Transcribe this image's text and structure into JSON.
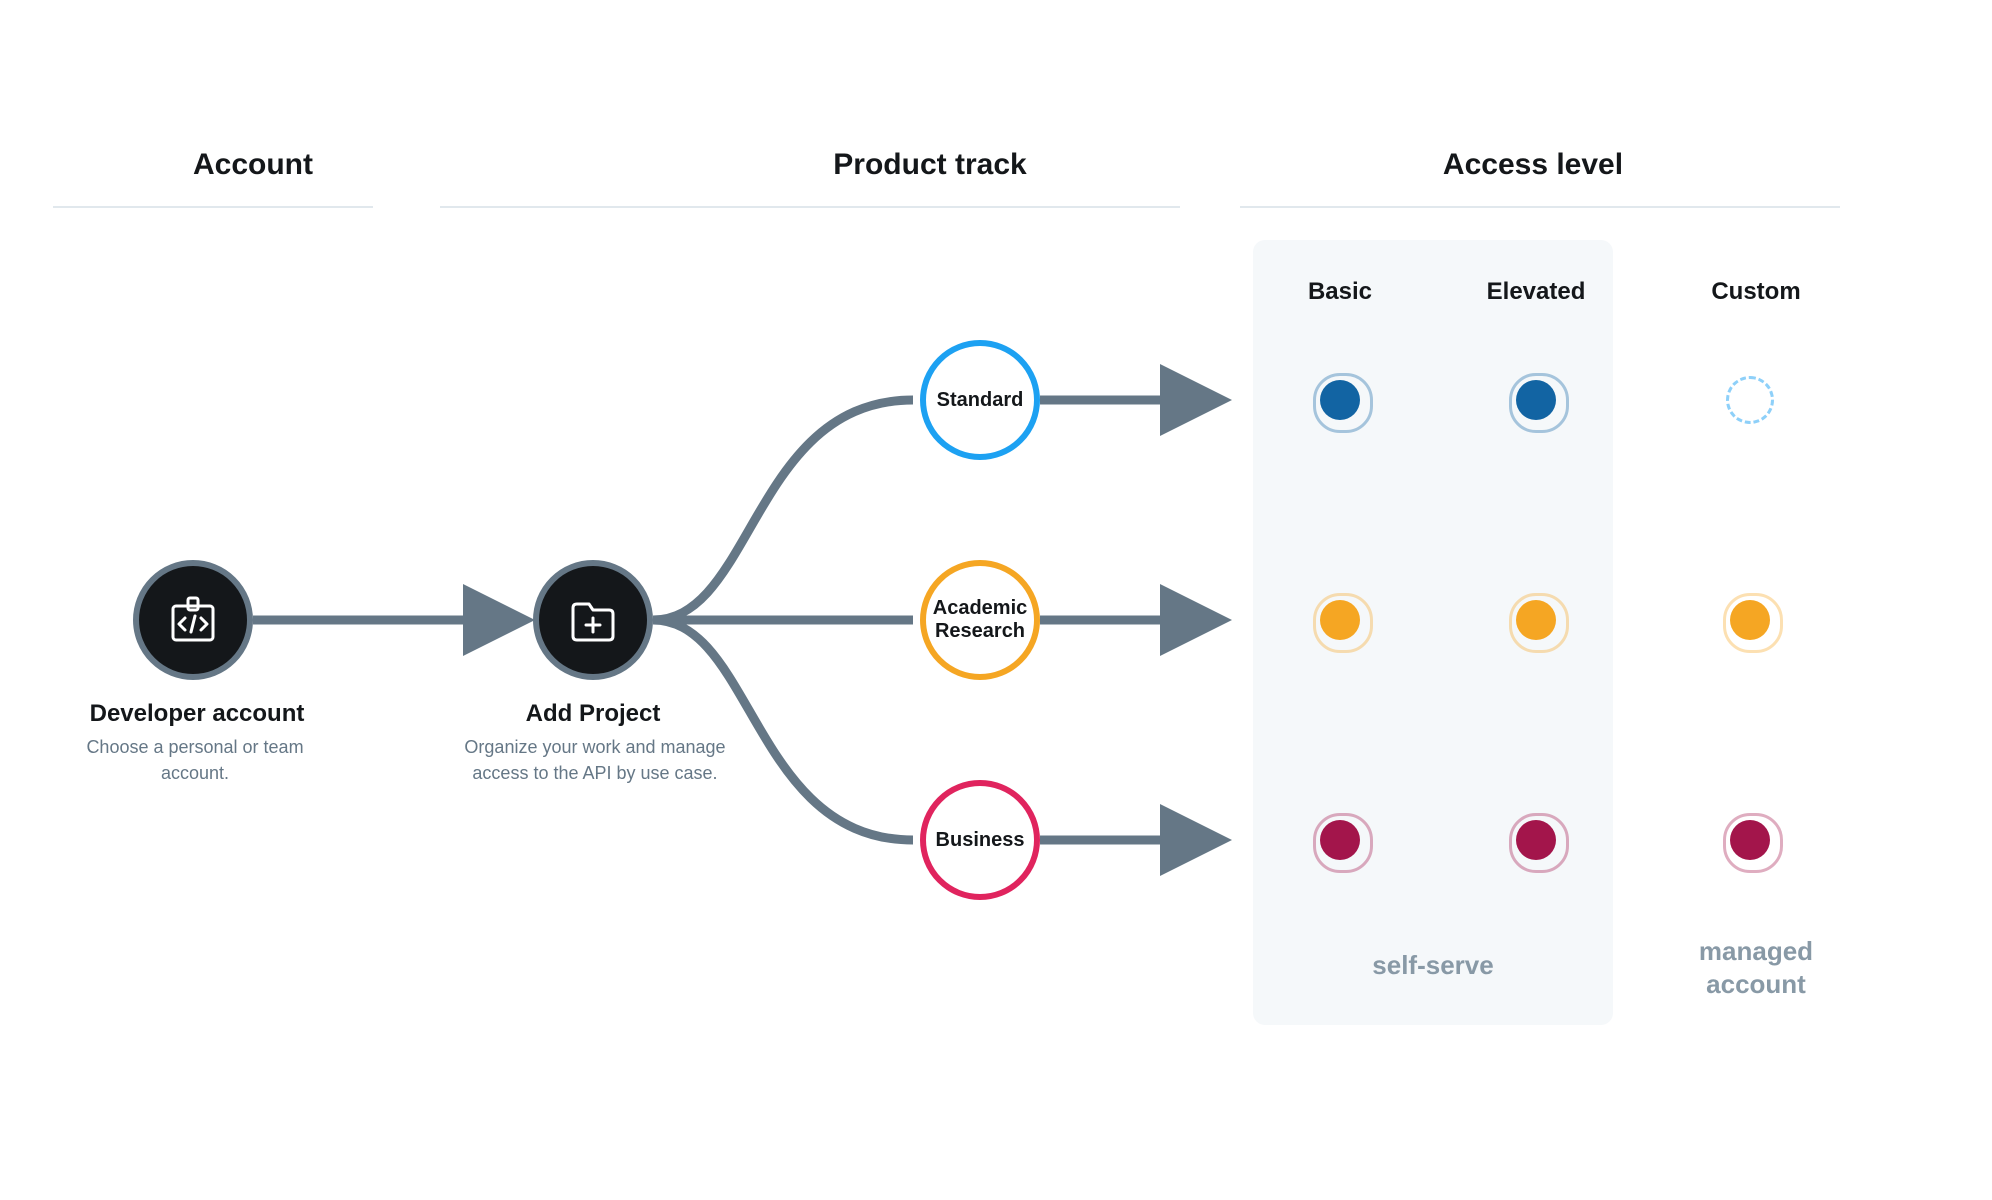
{
  "columns": {
    "account": "Account",
    "product_track": "Product track",
    "access_level": "Access level"
  },
  "nodes": {
    "developer": {
      "title": "Developer account",
      "desc": "Choose a personal or team account."
    },
    "project": {
      "title": "Add Project",
      "desc": "Organize your work and manage access to the API by use case."
    }
  },
  "tracks": {
    "standard": {
      "label": "Standard",
      "color": "#1da1f2"
    },
    "academic": {
      "label": "Academic Research",
      "color": "#f5a623"
    },
    "business": {
      "label": "Business",
      "color": "#e0245e"
    }
  },
  "access_levels": {
    "basic": "Basic",
    "elevated": "Elevated",
    "custom": "Custom"
  },
  "access_matrix": {
    "standard": {
      "basic": "solid",
      "elevated": "solid",
      "custom": "dashed"
    },
    "academic": {
      "basic": "solid",
      "elevated": "solid",
      "custom": "solid"
    },
    "business": {
      "basic": "solid",
      "elevated": "solid",
      "custom": "solid"
    }
  },
  "dot_colors": {
    "standard": "#1264a3",
    "academic": "#f5a623",
    "business": "#a3154b",
    "standard_dashed": "#8ed0f9"
  },
  "footer": {
    "self_serve": "self-serve",
    "managed": "managed account"
  }
}
